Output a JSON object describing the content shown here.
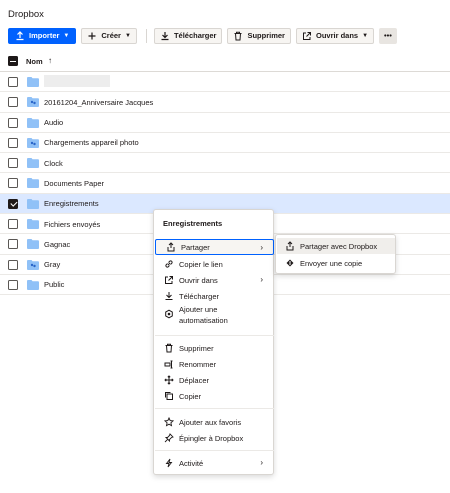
{
  "app": {
    "title": "Dropbox"
  },
  "toolbar": {
    "import_label": "Importer",
    "create_label": "Créer",
    "download_label": "Télécharger",
    "delete_label": "Supprimer",
    "open_in_label": "Ouvrir dans",
    "more_label": "•••"
  },
  "table": {
    "name_header": "Nom",
    "sort_indicator": "↑"
  },
  "files": [
    {
      "name": "",
      "shared": false,
      "checked": false
    },
    {
      "name": "20161204_Anniversaire Jacques",
      "shared": true,
      "checked": false
    },
    {
      "name": "Audio",
      "shared": false,
      "checked": false
    },
    {
      "name": "Chargements appareil photo",
      "shared": true,
      "checked": false
    },
    {
      "name": "Clock",
      "shared": false,
      "checked": false
    },
    {
      "name": "Documents Paper",
      "shared": false,
      "checked": false
    },
    {
      "name": "Enregistrements",
      "shared": false,
      "checked": true
    },
    {
      "name": "Fichiers envoyés",
      "shared": false,
      "checked": false
    },
    {
      "name": "Gagnac",
      "shared": false,
      "checked": false
    },
    {
      "name": "Gray",
      "shared": true,
      "checked": false
    },
    {
      "name": "Public",
      "shared": false,
      "checked": false
    }
  ],
  "context_menu": {
    "title": "Enregistrements",
    "share": "Partager",
    "copy_link": "Copier le lien",
    "open_in": "Ouvrir dans",
    "download": "Télécharger",
    "automation_line1": "Ajouter une",
    "automation_line2": "automatisation",
    "delete": "Supprimer",
    "rename": "Renommer",
    "move": "Déplacer",
    "copy": "Copier",
    "add_favorites": "Ajouter aux favoris",
    "pin": "Épingler à Dropbox",
    "activity": "Activité",
    "arrow": "›"
  },
  "share_submenu": {
    "share_dropbox": "Partager avec Dropbox",
    "send_copy": "Envoyer une copie"
  },
  "colors": {
    "accent": "#0061fe",
    "folder": "#90c1f7",
    "selected_row": "#dbe8ff"
  }
}
